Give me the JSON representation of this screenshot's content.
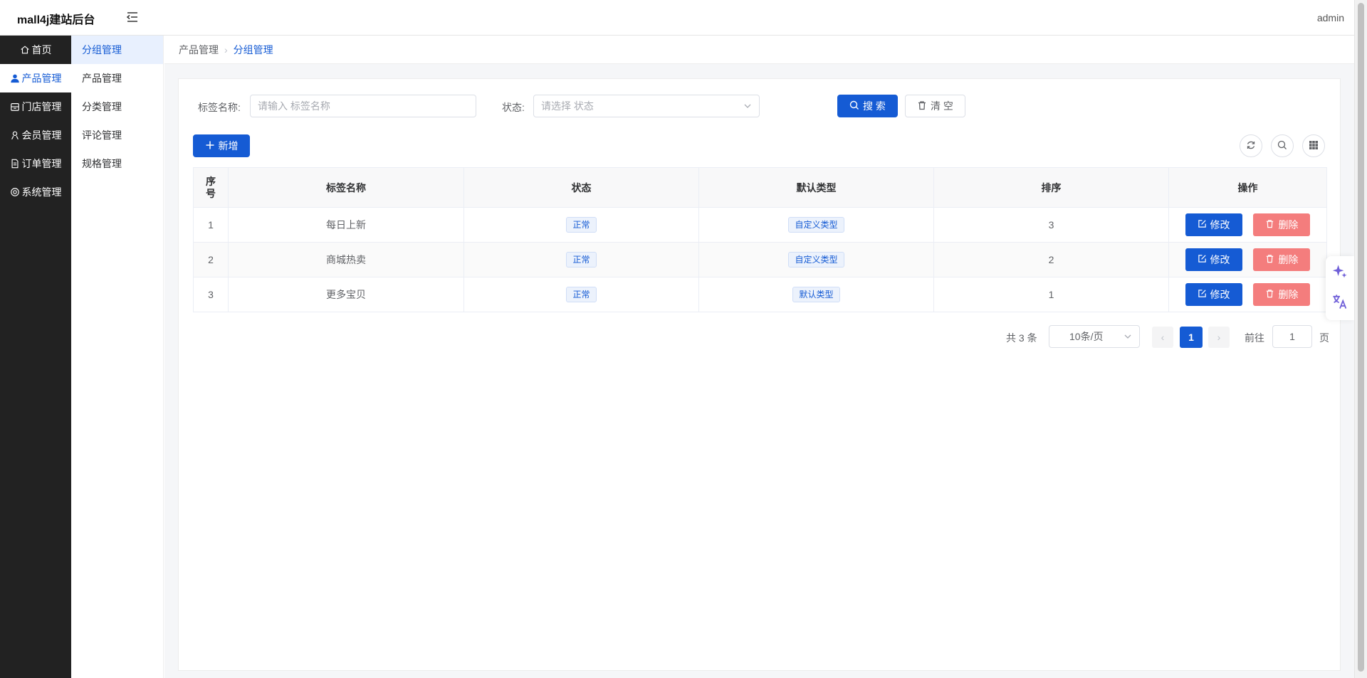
{
  "header": {
    "logo": "mall4j建站后台",
    "user": "admin"
  },
  "sidebar": {
    "items": [
      {
        "label": "首页",
        "icon": "home-icon"
      },
      {
        "label": "产品管理",
        "icon": "user-icon",
        "active": true
      },
      {
        "label": "门店管理",
        "icon": "store-icon"
      },
      {
        "label": "会员管理",
        "icon": "member-icon"
      },
      {
        "label": "订单管理",
        "icon": "document-icon"
      },
      {
        "label": "系统管理",
        "icon": "gear-icon"
      }
    ]
  },
  "subnav": {
    "items": [
      {
        "label": "分组管理",
        "active": true
      },
      {
        "label": "产品管理"
      },
      {
        "label": "分类管理"
      },
      {
        "label": "评论管理"
      },
      {
        "label": "规格管理"
      }
    ]
  },
  "breadcrumb": {
    "parent": "产品管理",
    "current": "分组管理"
  },
  "search": {
    "name_label": "标签名称:",
    "name_placeholder": "请输入 标签名称",
    "status_label": "状态:",
    "status_placeholder": "请选择 状态",
    "search_button": "搜 索",
    "clear_button": "清 空"
  },
  "toolbar": {
    "add_button": "新增"
  },
  "table": {
    "headers": {
      "index": "序号",
      "name": "标签名称",
      "status": "状态",
      "type": "默认类型",
      "sort": "排序",
      "actions": "操作"
    },
    "rows": [
      {
        "index": "1",
        "name": "每日上新",
        "status": "正常",
        "type": "自定义类型",
        "sort": "3"
      },
      {
        "index": "2",
        "name": "商城热卖",
        "status": "正常",
        "type": "自定义类型",
        "sort": "2"
      },
      {
        "index": "3",
        "name": "更多宝贝",
        "status": "正常",
        "type": "默认类型",
        "sort": "1"
      }
    ],
    "edit_label": "修改",
    "delete_label": "删除"
  },
  "pagination": {
    "total": "共 3 条",
    "page_size": "10条/页",
    "current_page": "1",
    "goto_label": "前往",
    "goto_value": "1",
    "page_suffix": "页"
  },
  "colors": {
    "primary": "#155bd4",
    "danger": "#f47d7d",
    "sidebar_bg": "#222222"
  }
}
